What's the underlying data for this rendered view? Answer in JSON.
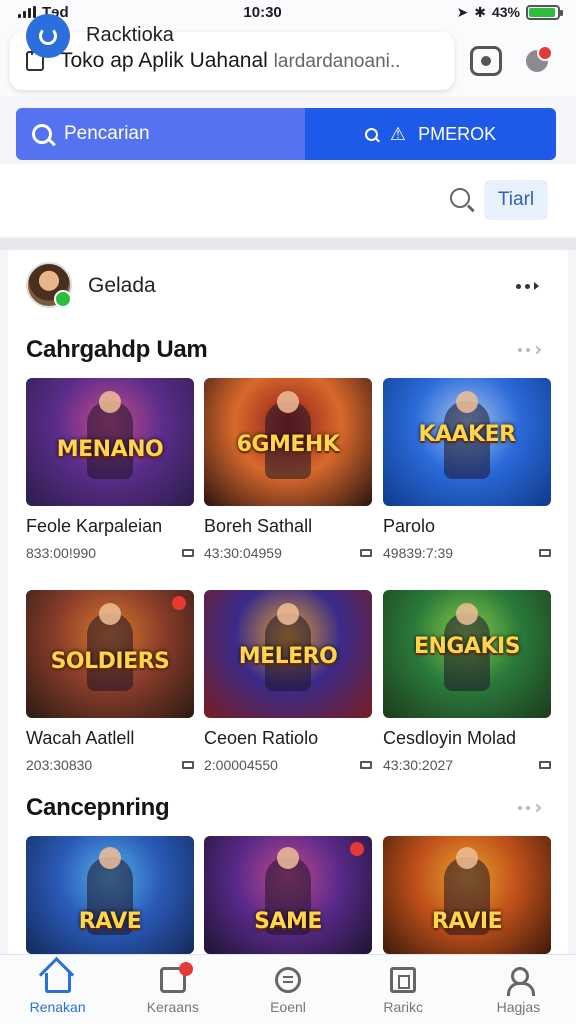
{
  "status": {
    "carrier": "Tɘd",
    "time": "10:30",
    "battery": "43%",
    "battery_color": "#2dbd3c"
  },
  "address_bar": {
    "title": "Toko ap Aplik Uahanal",
    "subtitle": "lardardanoani..",
    "icons": [
      "lock-icon",
      "profile-icon",
      "notification-icon"
    ]
  },
  "search": {
    "left_label": "Pencarian",
    "right_label": "PMEROK",
    "left_color": "#5572f0",
    "right_color": "#1e5ae8"
  },
  "filter": {
    "label": "Racktioka",
    "chip": "Tiarl"
  },
  "user": {
    "name": "Gelada"
  },
  "sections": [
    {
      "title": "Cahrgahdp Uam",
      "games": [
        {
          "title": "Feole Karpaleian",
          "meta": "833:00!990",
          "thumb_text": "MENANO",
          "colors": [
            "#5b2d8a",
            "#c64b8a",
            "#2b1d4a"
          ]
        },
        {
          "title": "Boreh Sathall",
          "meta": "43:30:04959",
          "thumb_text": "6GMEHK",
          "colors": [
            "#d9692a",
            "#8b1d1d",
            "#2a1414"
          ]
        },
        {
          "title": "Parolo",
          "meta": "49839:7:39",
          "thumb_text": "KAAKER",
          "colors": [
            "#2a6ad9",
            "#a8c6ef",
            "#0f3a8a"
          ]
        }
      ]
    },
    {
      "title": "",
      "games": [
        {
          "title": "Wacah Aatlell",
          "meta": "203:30830",
          "thumb_text": "SOLDIERS",
          "colors": [
            "#8a3d2a",
            "#d77a2a",
            "#2a1a14"
          ],
          "badge": true
        },
        {
          "title": "Ceoen Ratiolo",
          "meta": "2:00004550",
          "thumb_text": "MELERO",
          "colors": [
            "#3a2a8a",
            "#e0a12a",
            "#7a1d1d"
          ]
        },
        {
          "title": "Cesdloyin Molad",
          "meta": "43:30:2027",
          "thumb_text": "ENGAKIS",
          "colors": [
            "#2a7a3a",
            "#8acb4a",
            "#1d3a1d"
          ]
        }
      ]
    },
    {
      "title": "Cancepnring",
      "games": [
        {
          "title": "",
          "meta": "",
          "thumb_text": "RAVE",
          "colors": [
            "#2a5ab8",
            "#56b0e8",
            "#142a5a"
          ]
        },
        {
          "title": "",
          "meta": "",
          "thumb_text": "SAME",
          "colors": [
            "#5a2a8a",
            "#c04a8a",
            "#1d1432"
          ],
          "badge": true
        },
        {
          "title": "",
          "meta": "",
          "thumb_text": "RAVIE",
          "colors": [
            "#c0501a",
            "#e8a02a",
            "#3a1a0a"
          ]
        }
      ]
    }
  ],
  "bottom_nav": [
    {
      "label": "Renakan",
      "icon": "home-icon",
      "active": true
    },
    {
      "label": "Keraans",
      "icon": "bag-icon",
      "active": false
    },
    {
      "label": "Eoenl",
      "icon": "chat-icon",
      "active": false
    },
    {
      "label": "Rarikc",
      "icon": "rank-icon",
      "active": false
    },
    {
      "label": "Hagjas",
      "icon": "person-icon",
      "active": false
    }
  ]
}
